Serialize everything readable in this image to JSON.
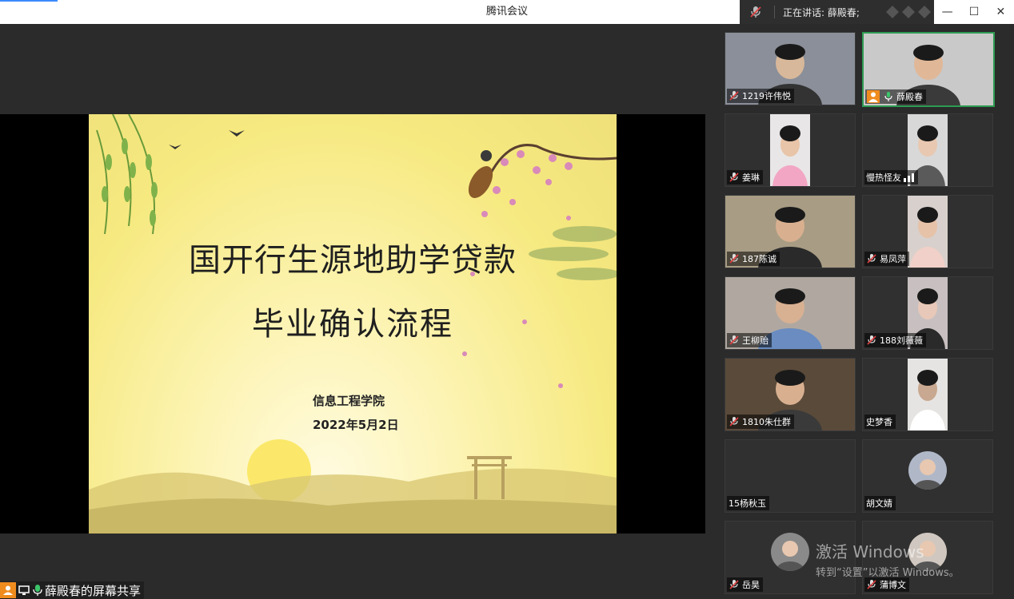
{
  "window": {
    "title": "腾讯会议",
    "speaking_text": "正在讲话: 薛殿春;",
    "minimize": "—",
    "maximize": "☐",
    "close": "✕"
  },
  "slide": {
    "title_line1": "国开行生源地助学贷款",
    "title_line2": "毕业确认流程",
    "organization": "信息工程学院",
    "date": "2022年5月2日"
  },
  "share_label": "薛殿春的屏幕共享",
  "participants": [
    {
      "name": "1219许伟悦",
      "muted": true
    },
    {
      "name": "薛殿春",
      "muted": false,
      "host": true
    },
    {
      "name": "姜琳",
      "muted": true
    },
    {
      "name": "慢热怪友",
      "muted": false
    },
    {
      "name": "187陈诚",
      "muted": true
    },
    {
      "name": "易凤萍",
      "muted": true
    },
    {
      "name": "王柳贻",
      "muted": true
    },
    {
      "name": "188刘薇薇",
      "muted": true
    },
    {
      "name": "1810朱仕群",
      "muted": true
    },
    {
      "name": "史梦香",
      "muted": false
    },
    {
      "name": "15杨秋玉",
      "muted": false
    },
    {
      "name": "胡文婧",
      "muted": false
    },
    {
      "name": "岳昊",
      "muted": true
    },
    {
      "name": "蒲博文",
      "muted": true
    }
  ],
  "watermark": {
    "line1": "激活 Windows",
    "line2": "转到“设置”以激活 Windows。"
  },
  "colors": {
    "active_border": "#2e9b52",
    "mic_muted": "#e04040",
    "mic_on": "#3cc46a",
    "host_badge": "#f08c1e"
  }
}
